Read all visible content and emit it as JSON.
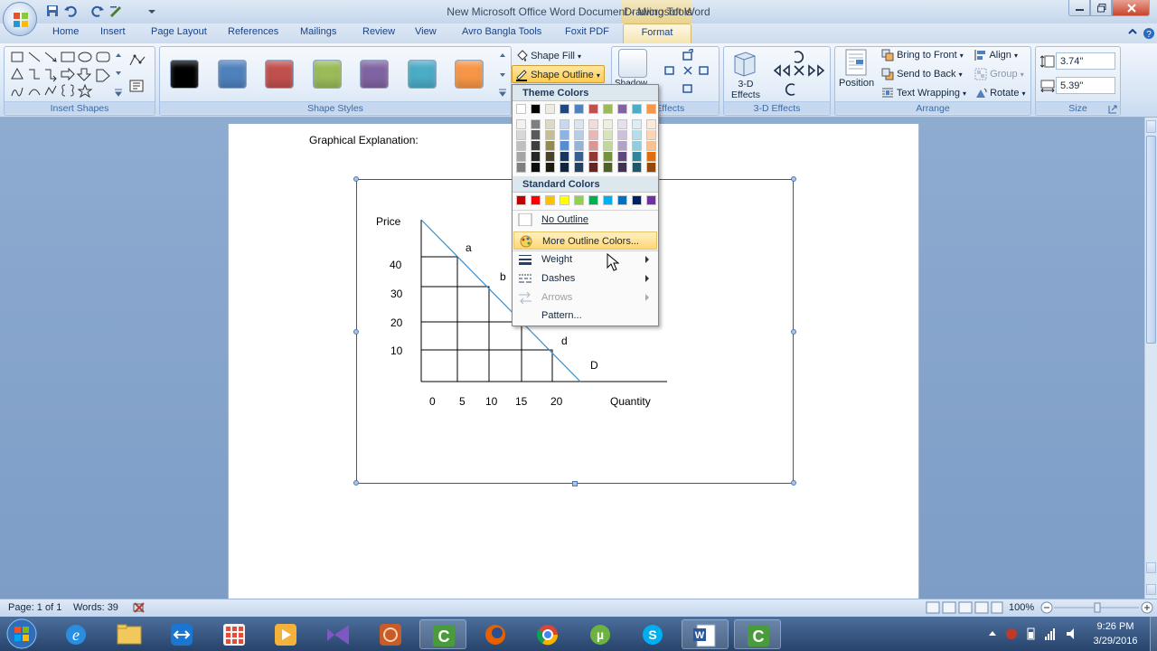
{
  "window": {
    "title": "New Microsoft Office Word Document - Microsoft Word",
    "contextual_label": "Drawing Tools"
  },
  "tabs": [
    "Home",
    "Insert",
    "Page Layout",
    "References",
    "Mailings",
    "Review",
    "View",
    "Avro Bangla Tools",
    "Foxit PDF"
  ],
  "active_tab": "Format",
  "ribbon": {
    "insert_shapes_label": "Insert Shapes",
    "shape_styles_label": "Shape Styles",
    "shape_fill": "Shape Fill",
    "shape_outline": "Shape Outline",
    "shadow_label": "Shadow",
    "shadow_effects_label": "w Effects",
    "three_d_button": "3-D Effects",
    "three_d_label": "3-D Effects",
    "position": "Position",
    "bring_to_front": "Bring to Front",
    "send_to_back": "Send to Back",
    "text_wrapping": "Text Wrapping",
    "align": "Align",
    "group": "Group",
    "rotate": "Rotate",
    "arrange_label": "Arrange",
    "height": "3.74\"",
    "width": "5.39\"",
    "size_label": "Size",
    "style_colors": [
      "#000000",
      "#4f81bd",
      "#c0504d",
      "#9bbb59",
      "#8064a2",
      "#4bacc6",
      "#f79646"
    ]
  },
  "dropdown": {
    "theme_colors_label": "Theme Colors",
    "standard_colors_label": "Standard Colors",
    "theme_top": [
      "#ffffff",
      "#000000",
      "#eeece1",
      "#1f497d",
      "#4f81bd",
      "#c0504d",
      "#9bbb59",
      "#8064a2",
      "#4bacc6",
      "#f79646"
    ],
    "theme_shades": [
      [
        "#f2f2f2",
        "#d8d8d8",
        "#bfbfbf",
        "#a5a5a5",
        "#7f7f7f"
      ],
      [
        "#7f7f7f",
        "#595959",
        "#3f3f3f",
        "#262626",
        "#0c0c0c"
      ],
      [
        "#ddd9c3",
        "#c4bd97",
        "#938953",
        "#494429",
        "#1d1b10"
      ],
      [
        "#c6d9f0",
        "#8db3e2",
        "#548dd4",
        "#17365d",
        "#0f243e"
      ],
      [
        "#dbe5f1",
        "#b8cce4",
        "#95b3d7",
        "#366092",
        "#244061"
      ],
      [
        "#f2dcdb",
        "#e5b9b7",
        "#d99694",
        "#953734",
        "#632423"
      ],
      [
        "#ebf1dd",
        "#d7e3bc",
        "#c3d69b",
        "#76923c",
        "#4f6128"
      ],
      [
        "#e5e0ec",
        "#ccc1d9",
        "#b2a2c7",
        "#5f497a",
        "#3f3151"
      ],
      [
        "#dbeef3",
        "#b7dde8",
        "#92cddc",
        "#31859b",
        "#205867"
      ],
      [
        "#fdeada",
        "#fbd5b5",
        "#fac08f",
        "#e36c09",
        "#974806"
      ]
    ],
    "standard": [
      "#c00000",
      "#ff0000",
      "#ffc000",
      "#ffff00",
      "#92d050",
      "#00b050",
      "#00b0f0",
      "#0070c0",
      "#002060",
      "#7030a0"
    ],
    "items": {
      "no_outline": "No Outline",
      "more_colors": "More Outline Colors...",
      "weight": "Weight",
      "dashes": "Dashes",
      "arrows": "Arrows",
      "pattern": "Pattern..."
    }
  },
  "document": {
    "heading": "Graphical Explanation:",
    "y_axis_title": "Price",
    "x_axis_title": "Quantity",
    "y_ticks": [
      "40",
      "30",
      "20",
      "10"
    ],
    "x_ticks": [
      "0",
      "5",
      "10",
      "15",
      "20"
    ],
    "points": [
      "a",
      "b",
      "d"
    ],
    "curve_label": "D"
  },
  "status": {
    "page": "Page: 1 of 1",
    "words": "Words: 39",
    "zoom": "100%"
  },
  "clock": {
    "time": "9:26 PM",
    "date": "3/29/2016"
  }
}
